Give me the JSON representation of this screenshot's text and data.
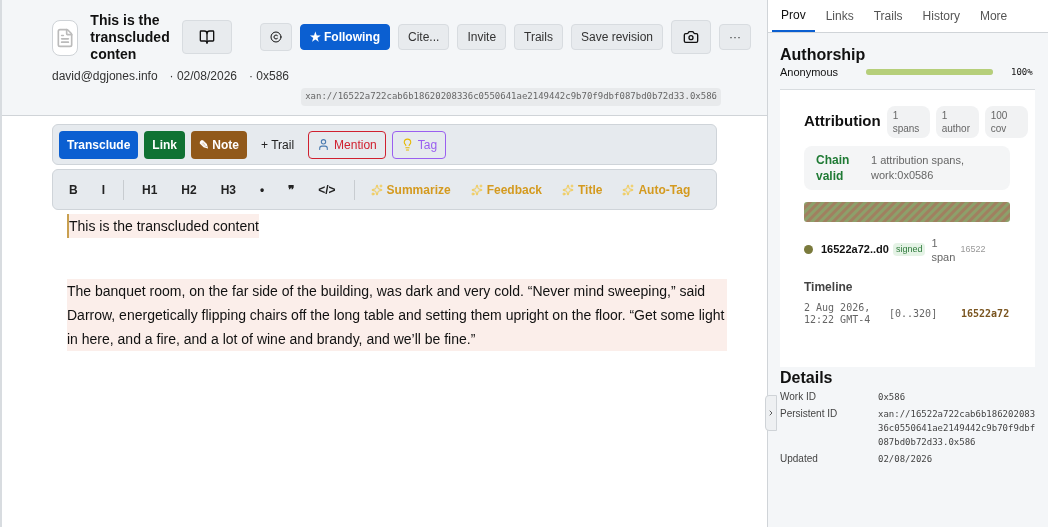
{
  "document": {
    "title": "This is the transcluded conten",
    "author": "david@dgjones.info",
    "date": "· 02/08/2026",
    "work_id": "· 0x586",
    "address": "xan://16522a722cab6b18620208336c0550641ae2149442c9b70f9dbf087bd0b72d33.0x586"
  },
  "header_actions": [
    {
      "kind": "book"
    },
    {
      "kind": "copyright"
    },
    {
      "kind": "primary",
      "label": "★ Following"
    },
    {
      "kind": "text",
      "label": "Cite..."
    },
    {
      "kind": "text",
      "label": "Invite"
    },
    {
      "kind": "text",
      "label": "Trails"
    },
    {
      "kind": "text",
      "label": "Save revision"
    },
    {
      "kind": "camera"
    },
    {
      "kind": "text",
      "label": "···"
    }
  ],
  "link_toolbar": [
    {
      "kind": "filled",
      "label": "Transclude",
      "color": "#0b5fd1"
    },
    {
      "kind": "filled",
      "label": "Link",
      "color": "#107233"
    },
    {
      "kind": "filled",
      "label": "✎ Note",
      "color": "#91591a"
    },
    {
      "kind": "plain",
      "label": "+ Trail"
    },
    {
      "kind": "mention",
      "label": "Mention",
      "color": "#d0202f"
    },
    {
      "kind": "tag",
      "label": "Tag",
      "color": "#9a5ff0"
    }
  ],
  "format_toolbar": [
    {
      "kind": "format",
      "label": "B"
    },
    {
      "kind": "format",
      "label": "I"
    },
    {
      "kind": "divider"
    },
    {
      "kind": "format",
      "label": "H1"
    },
    {
      "kind": "format",
      "label": "H2"
    },
    {
      "kind": "format",
      "label": "H3"
    },
    {
      "kind": "format",
      "label": "•"
    },
    {
      "kind": "format",
      "label": "❞"
    },
    {
      "kind": "format",
      "label": "</>"
    },
    {
      "kind": "divider"
    },
    {
      "kind": "ai",
      "label": "Summarize"
    },
    {
      "kind": "ai",
      "label": "Feedback"
    },
    {
      "kind": "ai",
      "label": "Title"
    },
    {
      "kind": "ai",
      "label": "Auto-Tag"
    }
  ],
  "content": [
    "This is the transcluded content",
    "The banquet room, on the far side of the building, was dark and very cold. “Never mind sweeping,” said Darrow, energetically flipping chairs off the long table and setting them upright on the floor. “Get some light in here, and a fire, and a lot of wine and brandy, and we’ll be fine.”"
  ],
  "tabs": [
    {
      "label": "Prov",
      "selected": true
    },
    {
      "label": "Links",
      "selected": false
    },
    {
      "label": "Trails",
      "selected": false
    },
    {
      "label": "History",
      "selected": false
    },
    {
      "label": "More",
      "selected": false
    }
  ],
  "authorship": {
    "title": "Authorship",
    "authors": [
      {
        "name": "Anonymous",
        "level": 1,
        "reading": "100%"
      }
    ]
  },
  "attribution": {
    "title": "Attribution",
    "badges": [
      "1 spans",
      "1 author",
      "100 cov"
    ],
    "chain_status": "Chain valid",
    "chain_detail": "1 attribution spans, work:0x0586",
    "entries": [
      {
        "author": "16522a72..d0",
        "badge": "signed",
        "spans": "1 span",
        "hash": "16522"
      }
    ],
    "timeline_title": "Timeline",
    "timeline": [
      {
        "time": "2 Aug 2026, 12:22 GMT-4",
        "range": "[0..320]",
        "author": "16522a72"
      }
    ]
  },
  "details": {
    "title": "Details",
    "rows": [
      {
        "label": "Work ID",
        "value": "0x586"
      },
      {
        "label": "Persistent ID",
        "value": "xan://16522a722cab6b18620208336c0550641ae2149442c9b70f9dbf087bd0b72d33.0x586"
      },
      {
        "label": "Updated",
        "value": "02/08/2026"
      }
    ]
  }
}
